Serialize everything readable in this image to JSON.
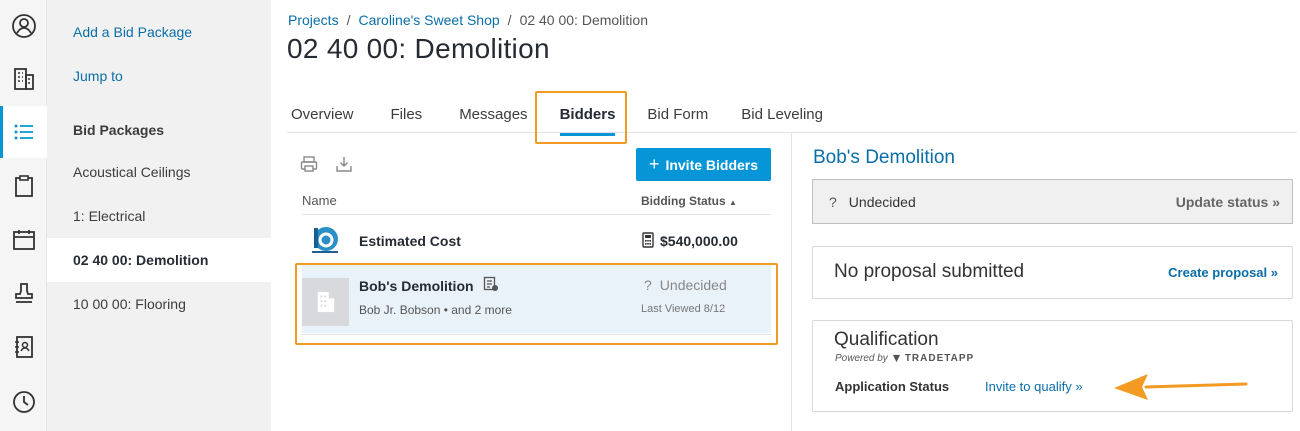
{
  "sidebar": {
    "add_bid_package": "Add a Bid Package",
    "jump_to": "Jump to",
    "heading": "Bid Packages",
    "items": [
      {
        "label": "Acoustical Ceilings"
      },
      {
        "label": "1: Electrical"
      },
      {
        "label": "02 40 00: Demolition"
      },
      {
        "label": "10 00 00: Flooring"
      }
    ]
  },
  "breadcrumb": {
    "projects": "Projects",
    "separator": "/",
    "project": "Caroline's Sweet Shop",
    "current": "02 40 00: Demolition"
  },
  "page_title": "02 40 00: Demolition",
  "tabs": [
    {
      "label": "Overview"
    },
    {
      "label": "Files"
    },
    {
      "label": "Messages"
    },
    {
      "label": "Bidders"
    },
    {
      "label": "Bid Form"
    },
    {
      "label": "Bid Leveling"
    }
  ],
  "bidders": {
    "invite_button": "Invite Bidders",
    "invite_icon": "+",
    "col_name": "Name",
    "col_status": "Bidding Status",
    "sort_icon": "▲",
    "estimated": {
      "name": "Estimated Cost",
      "value": "$540,000.00"
    },
    "bob": {
      "name": "Bob's Demolition",
      "contacts": "Bob Jr. Bobson • and 2 more",
      "status_icon": "?",
      "status": "Undecided",
      "last_viewed": "Last Viewed 8/12"
    }
  },
  "detail": {
    "name": "Bob's Demolition",
    "status_icon": "?",
    "status": "Undecided",
    "update_status": "Update status »",
    "proposal_text": "No proposal submitted",
    "create_proposal": "Create proposal »",
    "qualification_title": "Qualification",
    "powered_by": "Powered by",
    "tradetapp": "TRADETAPP",
    "application_status_label": "Application Status",
    "invite_to_qualify": "Invite to qualify »"
  },
  "colors": {
    "accent": "#0696d7",
    "link": "#0a6ea9",
    "highlight": "#f39a23"
  }
}
